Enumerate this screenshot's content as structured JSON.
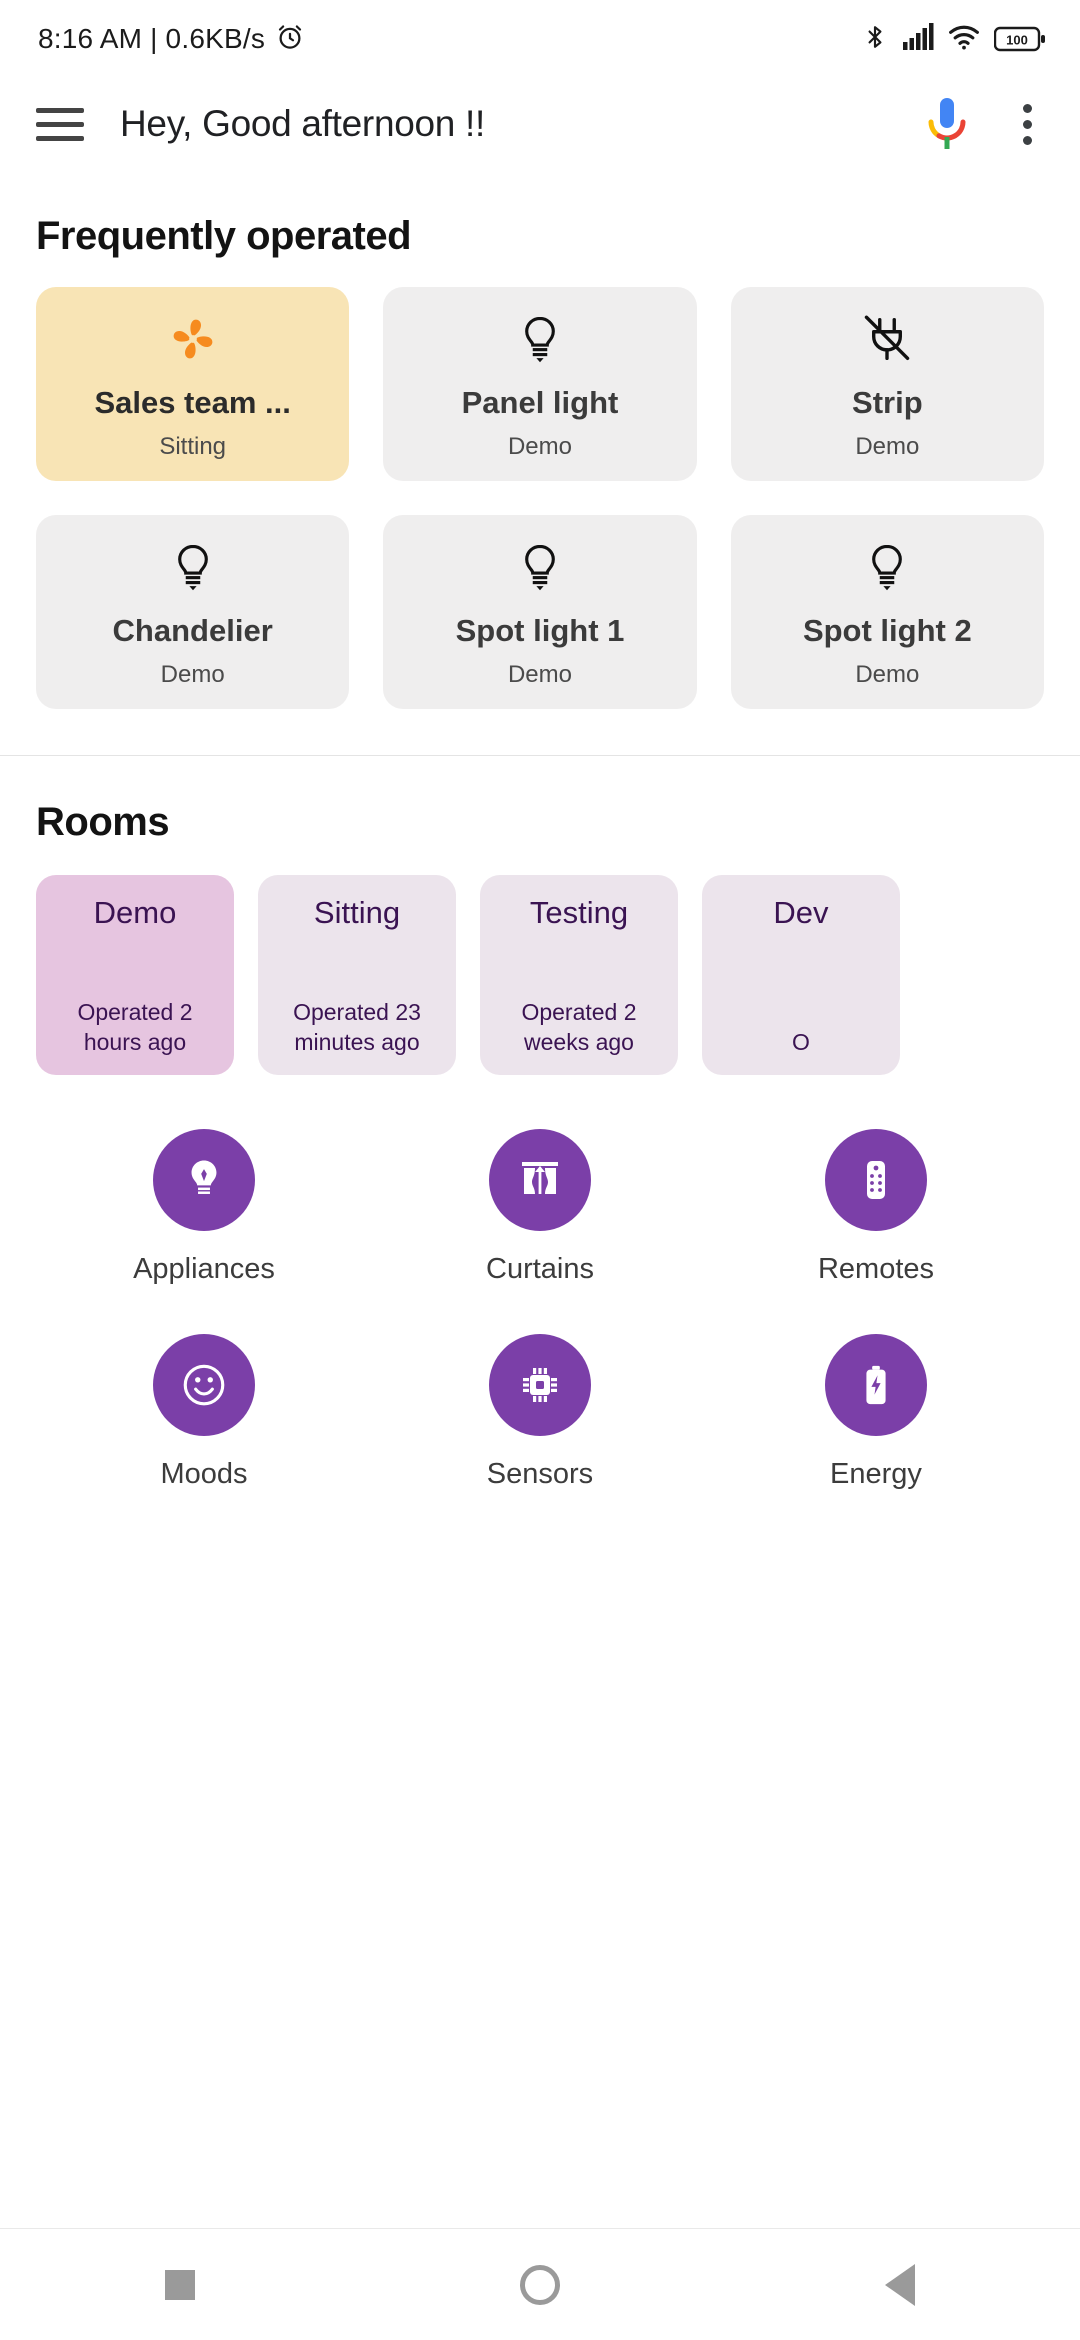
{
  "status_bar": {
    "time_and_speed": "8:16 AM | 0.6KB/s",
    "alarm_icon": "alarm-icon",
    "bluetooth_icon": "bluetooth-icon",
    "signal_icon": "cellular-signal-icon",
    "wifi_icon": "wifi-icon",
    "battery_level": "100"
  },
  "app_bar": {
    "menu_icon": "hamburger-menu-icon",
    "title": "Hey, Good afternoon !!",
    "assistant_icon": "google-assistant-mic-icon",
    "overflow_icon": "overflow-menu-icon"
  },
  "frequent": {
    "title": "Frequently operated",
    "devices": [
      {
        "name": "Sales team ...",
        "room": "Sitting",
        "icon": "fan-icon",
        "state": "on"
      },
      {
        "name": "Panel light",
        "room": "Demo",
        "icon": "bulb-icon",
        "state": "off"
      },
      {
        "name": "Strip",
        "room": "Demo",
        "icon": "plug-off-icon",
        "state": "off"
      },
      {
        "name": "Chandelier",
        "room": "Demo",
        "icon": "bulb-icon",
        "state": "off"
      },
      {
        "name": "Spot light 1",
        "room": "Demo",
        "icon": "bulb-icon",
        "state": "off"
      },
      {
        "name": "Spot light 2",
        "room": "Demo",
        "icon": "bulb-icon",
        "state": "off"
      }
    ]
  },
  "rooms": {
    "title": "Rooms",
    "items": [
      {
        "name": "Demo",
        "meta": "Operated 2 hours ago",
        "selected": true
      },
      {
        "name": "Sitting",
        "meta": "Operated 23 minutes ago",
        "selected": false
      },
      {
        "name": "Testing",
        "meta": "Operated 2 weeks ago",
        "selected": false
      },
      {
        "name": "Dev",
        "meta": "O",
        "selected": false
      }
    ]
  },
  "categories": [
    {
      "label": "Appliances",
      "icon": "bulb-icon"
    },
    {
      "label": "Curtains",
      "icon": "curtains-icon"
    },
    {
      "label": "Remotes",
      "icon": "remote-control-icon"
    },
    {
      "label": "Moods",
      "icon": "smiley-icon"
    },
    {
      "label": "Sensors",
      "icon": "chip-sensor-icon"
    },
    {
      "label": "Energy",
      "icon": "battery-bolt-icon"
    }
  ],
  "navigation_bar": {
    "recents_label": "Recents",
    "home_label": "Home",
    "back_label": "Back"
  },
  "colors": {
    "accent_purple": "#7b3fa8",
    "active_card_yellow": "#f8e4b5",
    "card_grey": "#efeeee",
    "room_selected": "#e6c5e0",
    "room_default": "#ece4ec",
    "fan_orange": "#f68b1f",
    "room_text": "#3a1352"
  }
}
